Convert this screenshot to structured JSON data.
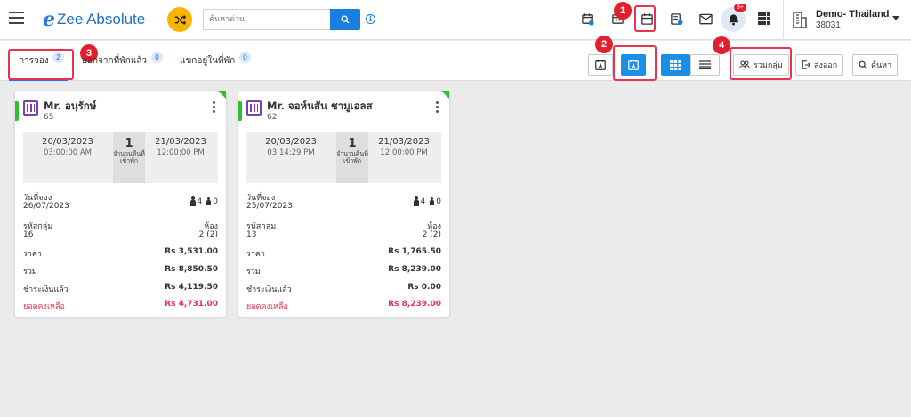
{
  "app": {
    "logo_e": "e",
    "name": "Zee Absolute"
  },
  "header": {
    "search_placeholder": "ค้นหาด่วน",
    "notification_count": "9+",
    "property_name": "Demo- Thailand",
    "property_id": "38031"
  },
  "markers": [
    "1",
    "2",
    "3",
    "4"
  ],
  "tabs": [
    {
      "label": "การจอง",
      "count": "2"
    },
    {
      "label": "ออกจากที่พักแล้ว",
      "count": "0"
    },
    {
      "label": "แขกอยู่ในที่พัก",
      "count": "0"
    }
  ],
  "toolbar": {
    "group_label": "รวมกลุ่ม",
    "export_label": "ส่งออก",
    "search_label": "ค้นหา"
  },
  "labels": {
    "nights": "จำนวนคืนที่เข้าพัก",
    "booking_date": "วันที่จอง",
    "group_code": "รหัสกลุ่ม",
    "rooms": "ห้อง",
    "price": "ราคา",
    "total": "รวม",
    "paid": "ชำระเงินแล้ว",
    "balance": "ยอดคงเหลือ"
  },
  "colors": {
    "accent": "#1a7ee0",
    "status": "#2cc02c",
    "balance": "#e8334e",
    "marker": "#e02030"
  },
  "cards": [
    {
      "guest": "Mr. อนุรักษ์",
      "guest_no": "65",
      "arrival_date": "20/03/2023",
      "arrival_time": "03:00:00 AM",
      "departure_date": "21/03/2023",
      "departure_time": "12:00:00 PM",
      "nights": "1",
      "booking_date": "26/07/2023",
      "adults": "4",
      "children": "0",
      "group_code": "16",
      "rooms": "2 (2)",
      "price": "Rs 3,531.00",
      "total": "Rs 8,850.50",
      "paid": "Rs 4,119.50",
      "balance": "Rs 4,731.00"
    },
    {
      "guest": "Mr. จอห์นสัน ชามูเอลส",
      "guest_no": "62",
      "arrival_date": "20/03/2023",
      "arrival_time": "03:14:29 PM",
      "departure_date": "21/03/2023",
      "departure_time": "12:00:00 PM",
      "nights": "1",
      "booking_date": "25/07/2023",
      "adults": "4",
      "children": "0",
      "group_code": "13",
      "rooms": "2 (2)",
      "price": "Rs 1,765.50",
      "total": "Rs 8,239.00",
      "paid": "Rs 0.00",
      "balance": "Rs 8,239.00"
    }
  ]
}
